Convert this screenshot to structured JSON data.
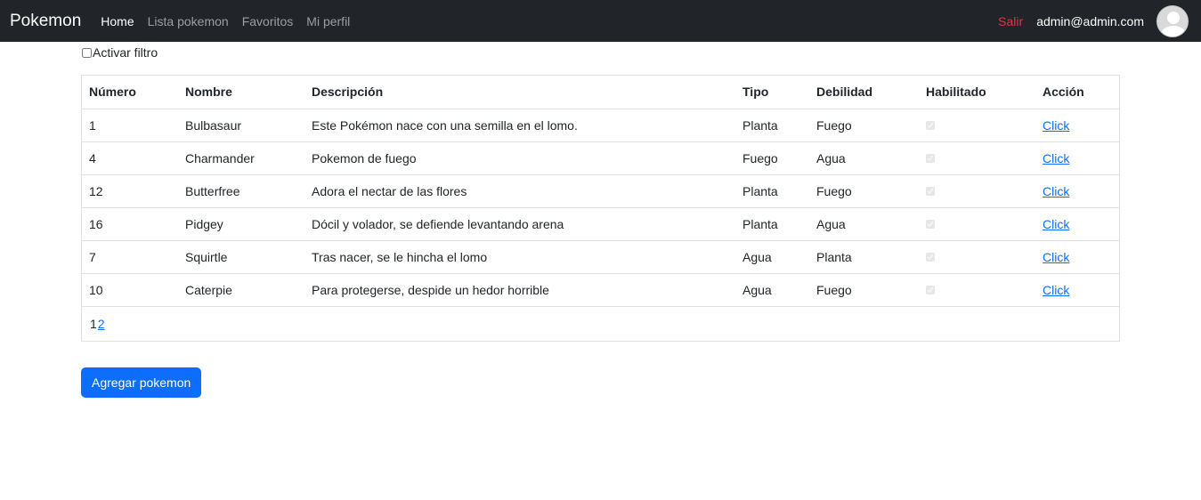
{
  "navbar": {
    "brand": "Pokemon",
    "links": [
      "Home",
      "Lista pokemon",
      "Favoritos",
      "Mi perfil"
    ],
    "logout": "Salir",
    "user_email": "admin@admin.com"
  },
  "filter": {
    "label": "Activar filtro",
    "checked": false
  },
  "table": {
    "headers": [
      "Número",
      "Nombre",
      "Descripción",
      "Tipo",
      "Debilidad",
      "Habilitado",
      "Acción"
    ],
    "rows": [
      {
        "numero": "1",
        "nombre": "Bulbasaur",
        "descripcion": "Este Pokémon nace con una semilla en el lomo.",
        "tipo": "Planta",
        "debilidad": "Fuego",
        "habilitado": true,
        "accion": "Click"
      },
      {
        "numero": "4",
        "nombre": "Charmander",
        "descripcion": "Pokemon de fuego",
        "tipo": "Fuego",
        "debilidad": "Agua",
        "habilitado": true,
        "accion": "Click"
      },
      {
        "numero": "12",
        "nombre": "Butterfree",
        "descripcion": "Adora el nectar de las flores",
        "tipo": "Planta",
        "debilidad": "Fuego",
        "habilitado": true,
        "accion": "Click"
      },
      {
        "numero": "16",
        "nombre": "Pidgey",
        "descripcion": "Dócil y volador, se defiende levantando arena",
        "tipo": "Planta",
        "debilidad": "Agua",
        "habilitado": true,
        "accion": "Click"
      },
      {
        "numero": "7",
        "nombre": "Squirtle",
        "descripcion": "Tras nacer, se le hincha el lomo",
        "tipo": "Agua",
        "debilidad": "Planta",
        "habilitado": true,
        "accion": "Click"
      },
      {
        "numero": "10",
        "nombre": "Caterpie",
        "descripcion": "Para protegerse, despide un hedor horrible",
        "tipo": "Agua",
        "debilidad": "Fuego",
        "habilitado": true,
        "accion": "Click"
      }
    ]
  },
  "pagination": {
    "current": "1",
    "next": "2"
  },
  "add_button": "Agregar pokemon",
  "colors": {
    "navbar_bg": "#212529",
    "accent": "#0d6efd",
    "logout": "#dc3545"
  },
  "icons": {
    "avatar": "user-avatar-icon"
  }
}
